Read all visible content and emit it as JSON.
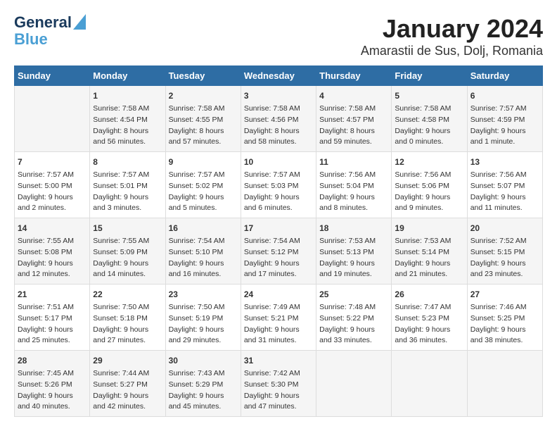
{
  "header": {
    "logo_line1": "General",
    "logo_line2": "Blue",
    "title": "January 2024",
    "subtitle": "Amarastii de Sus, Dolj, Romania"
  },
  "days_of_week": [
    "Sunday",
    "Monday",
    "Tuesday",
    "Wednesday",
    "Thursday",
    "Friday",
    "Saturday"
  ],
  "weeks": [
    [
      {
        "day": "",
        "info": ""
      },
      {
        "day": "1",
        "info": "Sunrise: 7:58 AM\nSunset: 4:54 PM\nDaylight: 8 hours\nand 56 minutes."
      },
      {
        "day": "2",
        "info": "Sunrise: 7:58 AM\nSunset: 4:55 PM\nDaylight: 8 hours\nand 57 minutes."
      },
      {
        "day": "3",
        "info": "Sunrise: 7:58 AM\nSunset: 4:56 PM\nDaylight: 8 hours\nand 58 minutes."
      },
      {
        "day": "4",
        "info": "Sunrise: 7:58 AM\nSunset: 4:57 PM\nDaylight: 8 hours\nand 59 minutes."
      },
      {
        "day": "5",
        "info": "Sunrise: 7:58 AM\nSunset: 4:58 PM\nDaylight: 9 hours\nand 0 minutes."
      },
      {
        "day": "6",
        "info": "Sunrise: 7:57 AM\nSunset: 4:59 PM\nDaylight: 9 hours\nand 1 minute."
      }
    ],
    [
      {
        "day": "7",
        "info": "Sunrise: 7:57 AM\nSunset: 5:00 PM\nDaylight: 9 hours\nand 2 minutes."
      },
      {
        "day": "8",
        "info": "Sunrise: 7:57 AM\nSunset: 5:01 PM\nDaylight: 9 hours\nand 3 minutes."
      },
      {
        "day": "9",
        "info": "Sunrise: 7:57 AM\nSunset: 5:02 PM\nDaylight: 9 hours\nand 5 minutes."
      },
      {
        "day": "10",
        "info": "Sunrise: 7:57 AM\nSunset: 5:03 PM\nDaylight: 9 hours\nand 6 minutes."
      },
      {
        "day": "11",
        "info": "Sunrise: 7:56 AM\nSunset: 5:04 PM\nDaylight: 9 hours\nand 8 minutes."
      },
      {
        "day": "12",
        "info": "Sunrise: 7:56 AM\nSunset: 5:06 PM\nDaylight: 9 hours\nand 9 minutes."
      },
      {
        "day": "13",
        "info": "Sunrise: 7:56 AM\nSunset: 5:07 PM\nDaylight: 9 hours\nand 11 minutes."
      }
    ],
    [
      {
        "day": "14",
        "info": "Sunrise: 7:55 AM\nSunset: 5:08 PM\nDaylight: 9 hours\nand 12 minutes."
      },
      {
        "day": "15",
        "info": "Sunrise: 7:55 AM\nSunset: 5:09 PM\nDaylight: 9 hours\nand 14 minutes."
      },
      {
        "day": "16",
        "info": "Sunrise: 7:54 AM\nSunset: 5:10 PM\nDaylight: 9 hours\nand 16 minutes."
      },
      {
        "day": "17",
        "info": "Sunrise: 7:54 AM\nSunset: 5:12 PM\nDaylight: 9 hours\nand 17 minutes."
      },
      {
        "day": "18",
        "info": "Sunrise: 7:53 AM\nSunset: 5:13 PM\nDaylight: 9 hours\nand 19 minutes."
      },
      {
        "day": "19",
        "info": "Sunrise: 7:53 AM\nSunset: 5:14 PM\nDaylight: 9 hours\nand 21 minutes."
      },
      {
        "day": "20",
        "info": "Sunrise: 7:52 AM\nSunset: 5:15 PM\nDaylight: 9 hours\nand 23 minutes."
      }
    ],
    [
      {
        "day": "21",
        "info": "Sunrise: 7:51 AM\nSunset: 5:17 PM\nDaylight: 9 hours\nand 25 minutes."
      },
      {
        "day": "22",
        "info": "Sunrise: 7:50 AM\nSunset: 5:18 PM\nDaylight: 9 hours\nand 27 minutes."
      },
      {
        "day": "23",
        "info": "Sunrise: 7:50 AM\nSunset: 5:19 PM\nDaylight: 9 hours\nand 29 minutes."
      },
      {
        "day": "24",
        "info": "Sunrise: 7:49 AM\nSunset: 5:21 PM\nDaylight: 9 hours\nand 31 minutes."
      },
      {
        "day": "25",
        "info": "Sunrise: 7:48 AM\nSunset: 5:22 PM\nDaylight: 9 hours\nand 33 minutes."
      },
      {
        "day": "26",
        "info": "Sunrise: 7:47 AM\nSunset: 5:23 PM\nDaylight: 9 hours\nand 36 minutes."
      },
      {
        "day": "27",
        "info": "Sunrise: 7:46 AM\nSunset: 5:25 PM\nDaylight: 9 hours\nand 38 minutes."
      }
    ],
    [
      {
        "day": "28",
        "info": "Sunrise: 7:45 AM\nSunset: 5:26 PM\nDaylight: 9 hours\nand 40 minutes."
      },
      {
        "day": "29",
        "info": "Sunrise: 7:44 AM\nSunset: 5:27 PM\nDaylight: 9 hours\nand 42 minutes."
      },
      {
        "day": "30",
        "info": "Sunrise: 7:43 AM\nSunset: 5:29 PM\nDaylight: 9 hours\nand 45 minutes."
      },
      {
        "day": "31",
        "info": "Sunrise: 7:42 AM\nSunset: 5:30 PM\nDaylight: 9 hours\nand 47 minutes."
      },
      {
        "day": "",
        "info": ""
      },
      {
        "day": "",
        "info": ""
      },
      {
        "day": "",
        "info": ""
      }
    ]
  ]
}
